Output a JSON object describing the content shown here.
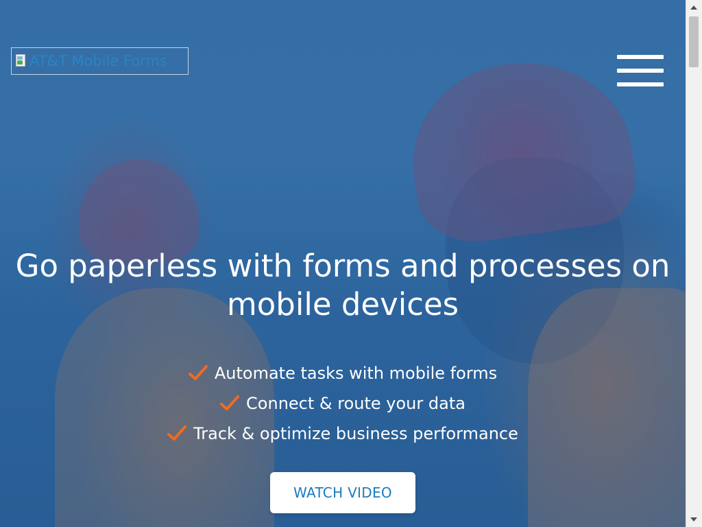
{
  "header": {
    "logo_alt": "AT&T Mobile Forms",
    "menu_icon": "hamburger-menu-icon"
  },
  "hero": {
    "headline": "Go paperless with forms and processes on mobile devices",
    "features": [
      "Automate tasks with mobile forms",
      "Connect & route your data",
      "Track & optimize business performance"
    ],
    "feature_icon": "check-icon",
    "cta_label": "WATCH VIDEO"
  },
  "colors": {
    "hero_overlay": "#3b74a9",
    "check": "#f26a21",
    "cta_text": "#1a7bbf",
    "logo_text": "#2a84c5"
  }
}
